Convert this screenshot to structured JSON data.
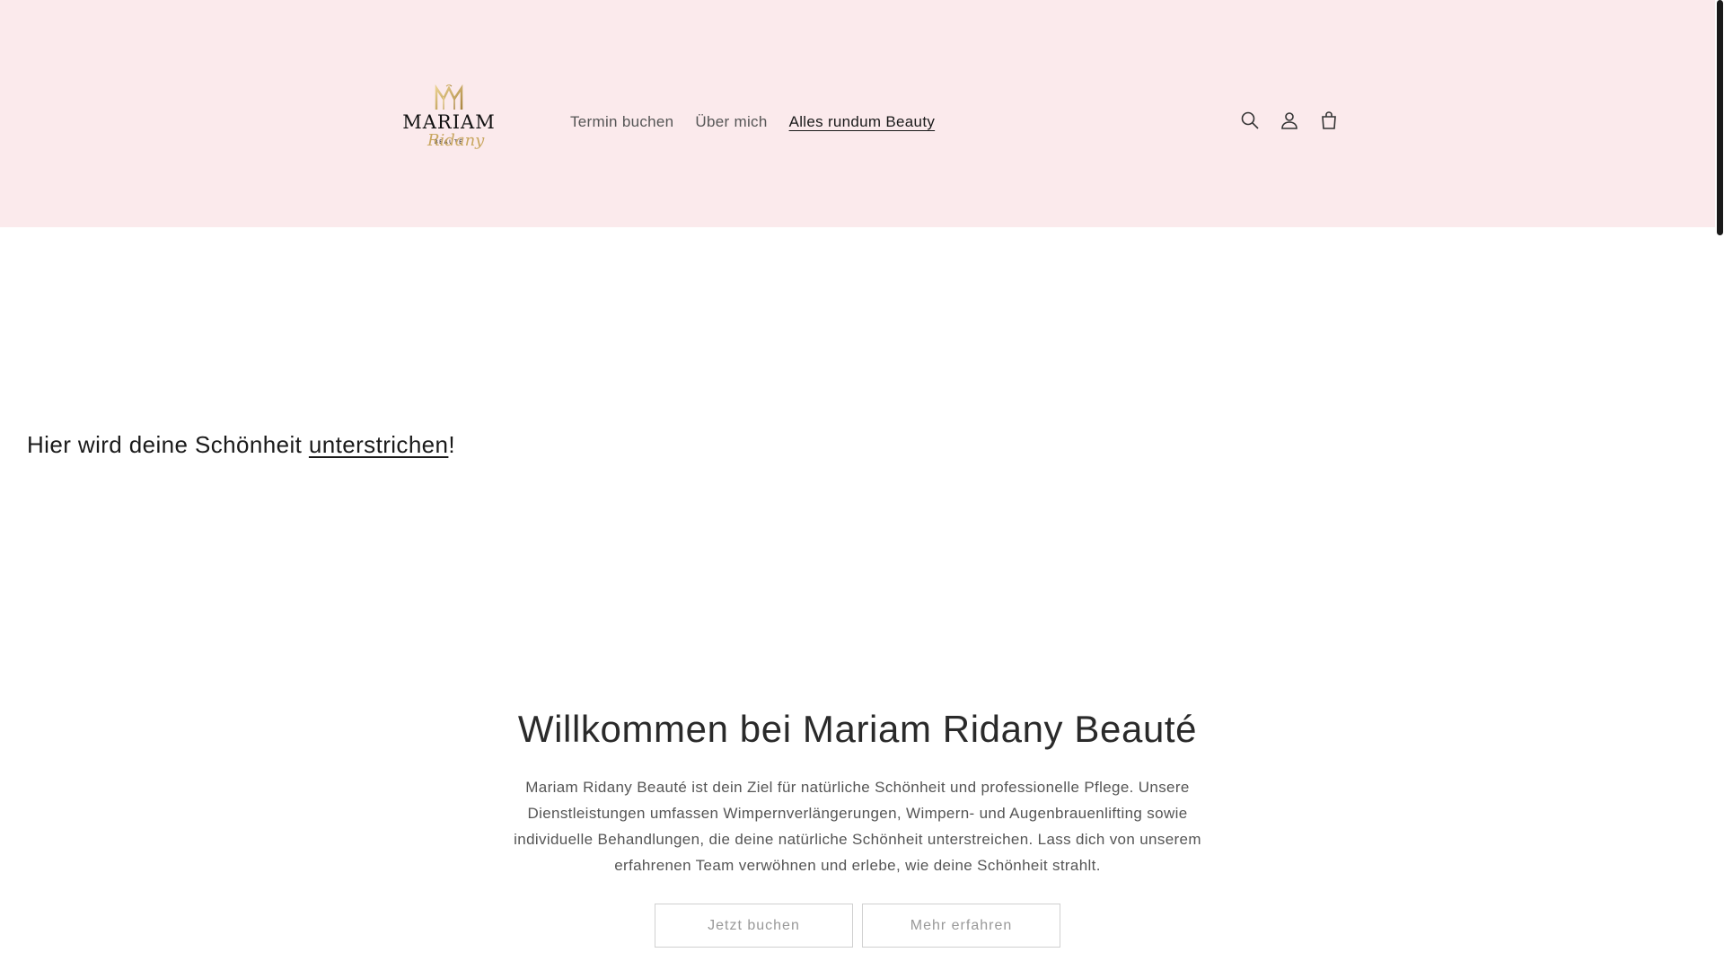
{
  "brand": {
    "name": "MARIAM",
    "subtitle": "BEAUTÉ",
    "script": "Ridany",
    "accent_color": "#c9a760"
  },
  "nav": {
    "items": [
      {
        "label": "Termin buchen",
        "active": false
      },
      {
        "label": "Über mich",
        "active": false
      },
      {
        "label": "Alles rundum Beauty",
        "active": true
      }
    ]
  },
  "header_icons": [
    "search-icon",
    "account-icon",
    "cart-icon"
  ],
  "colors": {
    "header_bg": "#fbeaec",
    "text": "#2a2a2a",
    "button_border": "#d0d0d0"
  },
  "hero": {
    "prefix": "Hier wird deine Schönheit ",
    "link": "unterstrichen",
    "suffix": "!"
  },
  "welcome": {
    "title": "Willkommen bei Mariam Ridany Beauté",
    "body": "Mariam Ridany Beauté ist dein Ziel für natürliche Schönheit und professionelle Pflege. Unsere Dienstleistungen umfassen Wimpernverlängerungen, Wimpern- und Augenbrauenlifting sowie individuelle Behandlungen, die deine natürliche Schönheit unterstreichen. Lass dich von unserem erfahrenen Team verwöhnen und erlebe, wie deine Schönheit strahlt.",
    "primary_button": "Jetzt buchen",
    "secondary_button": "Mehr erfahren"
  }
}
